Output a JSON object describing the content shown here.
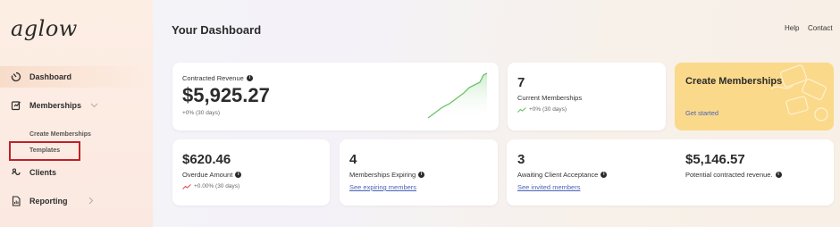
{
  "sidebar": {
    "logo": "aglow",
    "items": [
      {
        "label": "Dashboard",
        "icon": "dashboard-icon"
      },
      {
        "label": "Memberships",
        "icon": "memberships-icon"
      },
      {
        "label": "Clients",
        "icon": "clients-icon"
      },
      {
        "label": "Reporting",
        "icon": "reporting-icon"
      }
    ],
    "sub_items": [
      {
        "label": "Create Memberships"
      },
      {
        "label": "Templates"
      }
    ]
  },
  "header": {
    "title": "Your Dashboard",
    "links": [
      "Help",
      "Contact"
    ]
  },
  "cards": {
    "contracted_revenue": {
      "label": "Contracted Revenue",
      "value": "$5,925.27",
      "change": "+0% (30 days)"
    },
    "current_memberships": {
      "value": "7",
      "label": "Current Memberships",
      "change": "+0% (30 days)"
    },
    "create": {
      "title": "Create Memberships",
      "link": "Get started"
    },
    "overdue": {
      "value": "$620.46",
      "label": "Overdue Amount",
      "change": "+0.00% (30 days)"
    },
    "expiring": {
      "value": "4",
      "label": "Memberships Expiring",
      "link": "See expiring members"
    },
    "awaiting": {
      "value": "3",
      "label": "Awaiting Client Acceptance",
      "link": "See invited members"
    },
    "potential": {
      "value": "$5,146.57",
      "label": "Potential contracted revenue."
    }
  },
  "colors": {
    "accent_yellow": "#fbd98b",
    "trend_green": "#6cc26a",
    "trend_red": "#e0525a",
    "link_blue": "#4a63b8",
    "annotation_red": "#c0202a"
  }
}
